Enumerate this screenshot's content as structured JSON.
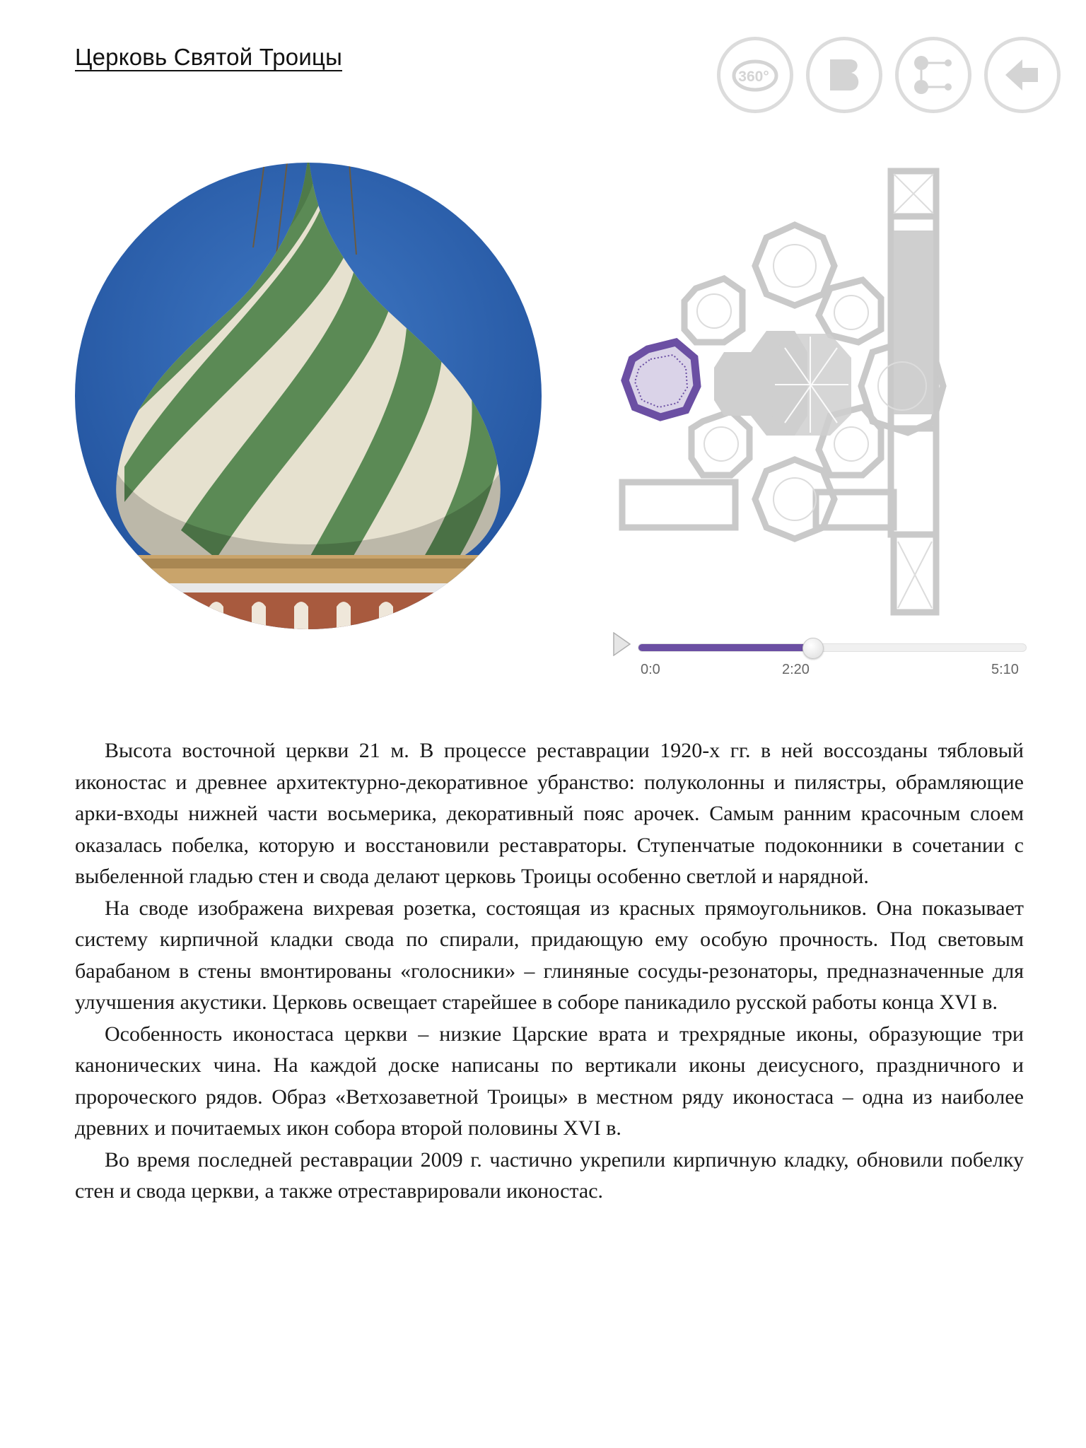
{
  "header": {
    "title": "Церковь Святой Троицы"
  },
  "toolbar": {
    "buttons": [
      {
        "icon": "view-360-icon",
        "label": "360°"
      },
      {
        "icon": "book-icon"
      },
      {
        "icon": "share-icon"
      },
      {
        "icon": "back-arrow-icon"
      }
    ],
    "icon_color": "#d4d4d4"
  },
  "media": {
    "photo_subject": "onion-dome-icon",
    "plan_highlight_color": "#6b4fa3"
  },
  "player": {
    "start_label": "0:0",
    "current_label": "2:20",
    "end_label": "5:10",
    "progress_fraction": 0.4516,
    "accent": "#6b4fa3"
  },
  "article": {
    "paragraphs": [
      "Высота восточной церкви 21 м. В процессе реставрации 1920-х гг. в ней воссозданы тябловый иконостас и древнее архитектурно-декоративное убранство: полуколонны и пилястры, обрамляющие арки-входы нижней части восьмерика, декоративный пояс арочек. Самым ранним красочным слоем оказалась побелка, которую и восстановили реставраторы. Ступенчатые подоконники в сочетании с выбеленной гладью стен и свода делают церковь Троицы особенно светлой и нарядной.",
      "На своде изображена вихревая розетка, состоящая из красных прямоугольников. Она показывает систему кирпичной кладки свода по спирали, придающую ему особую прочность. Под световым барабаном в стены вмонтированы «голосники» – глиняные сосуды-резонаторы, предназначенные для улучшения акустики. Церковь освещает старейшее в соборе паникадило русской работы конца XVI в.",
      "Особенность иконостаса церкви – низкие Царские врата и трехрядные иконы, образующие три канонических чина. На каждой доске написаны по вертикали иконы деисусного, праздничного и пророческого рядов. Образ «Ветхозаветной Троицы» в местном ряду иконостаса – одна из наиболее древних и почитаемых икон собора второй половины XVI в.",
      "Во время последней реставрации 2009 г. частично укрепили кирпичную кладку, обновили побелку стен и свода церкви, а также отреставрировали иконостас."
    ]
  }
}
